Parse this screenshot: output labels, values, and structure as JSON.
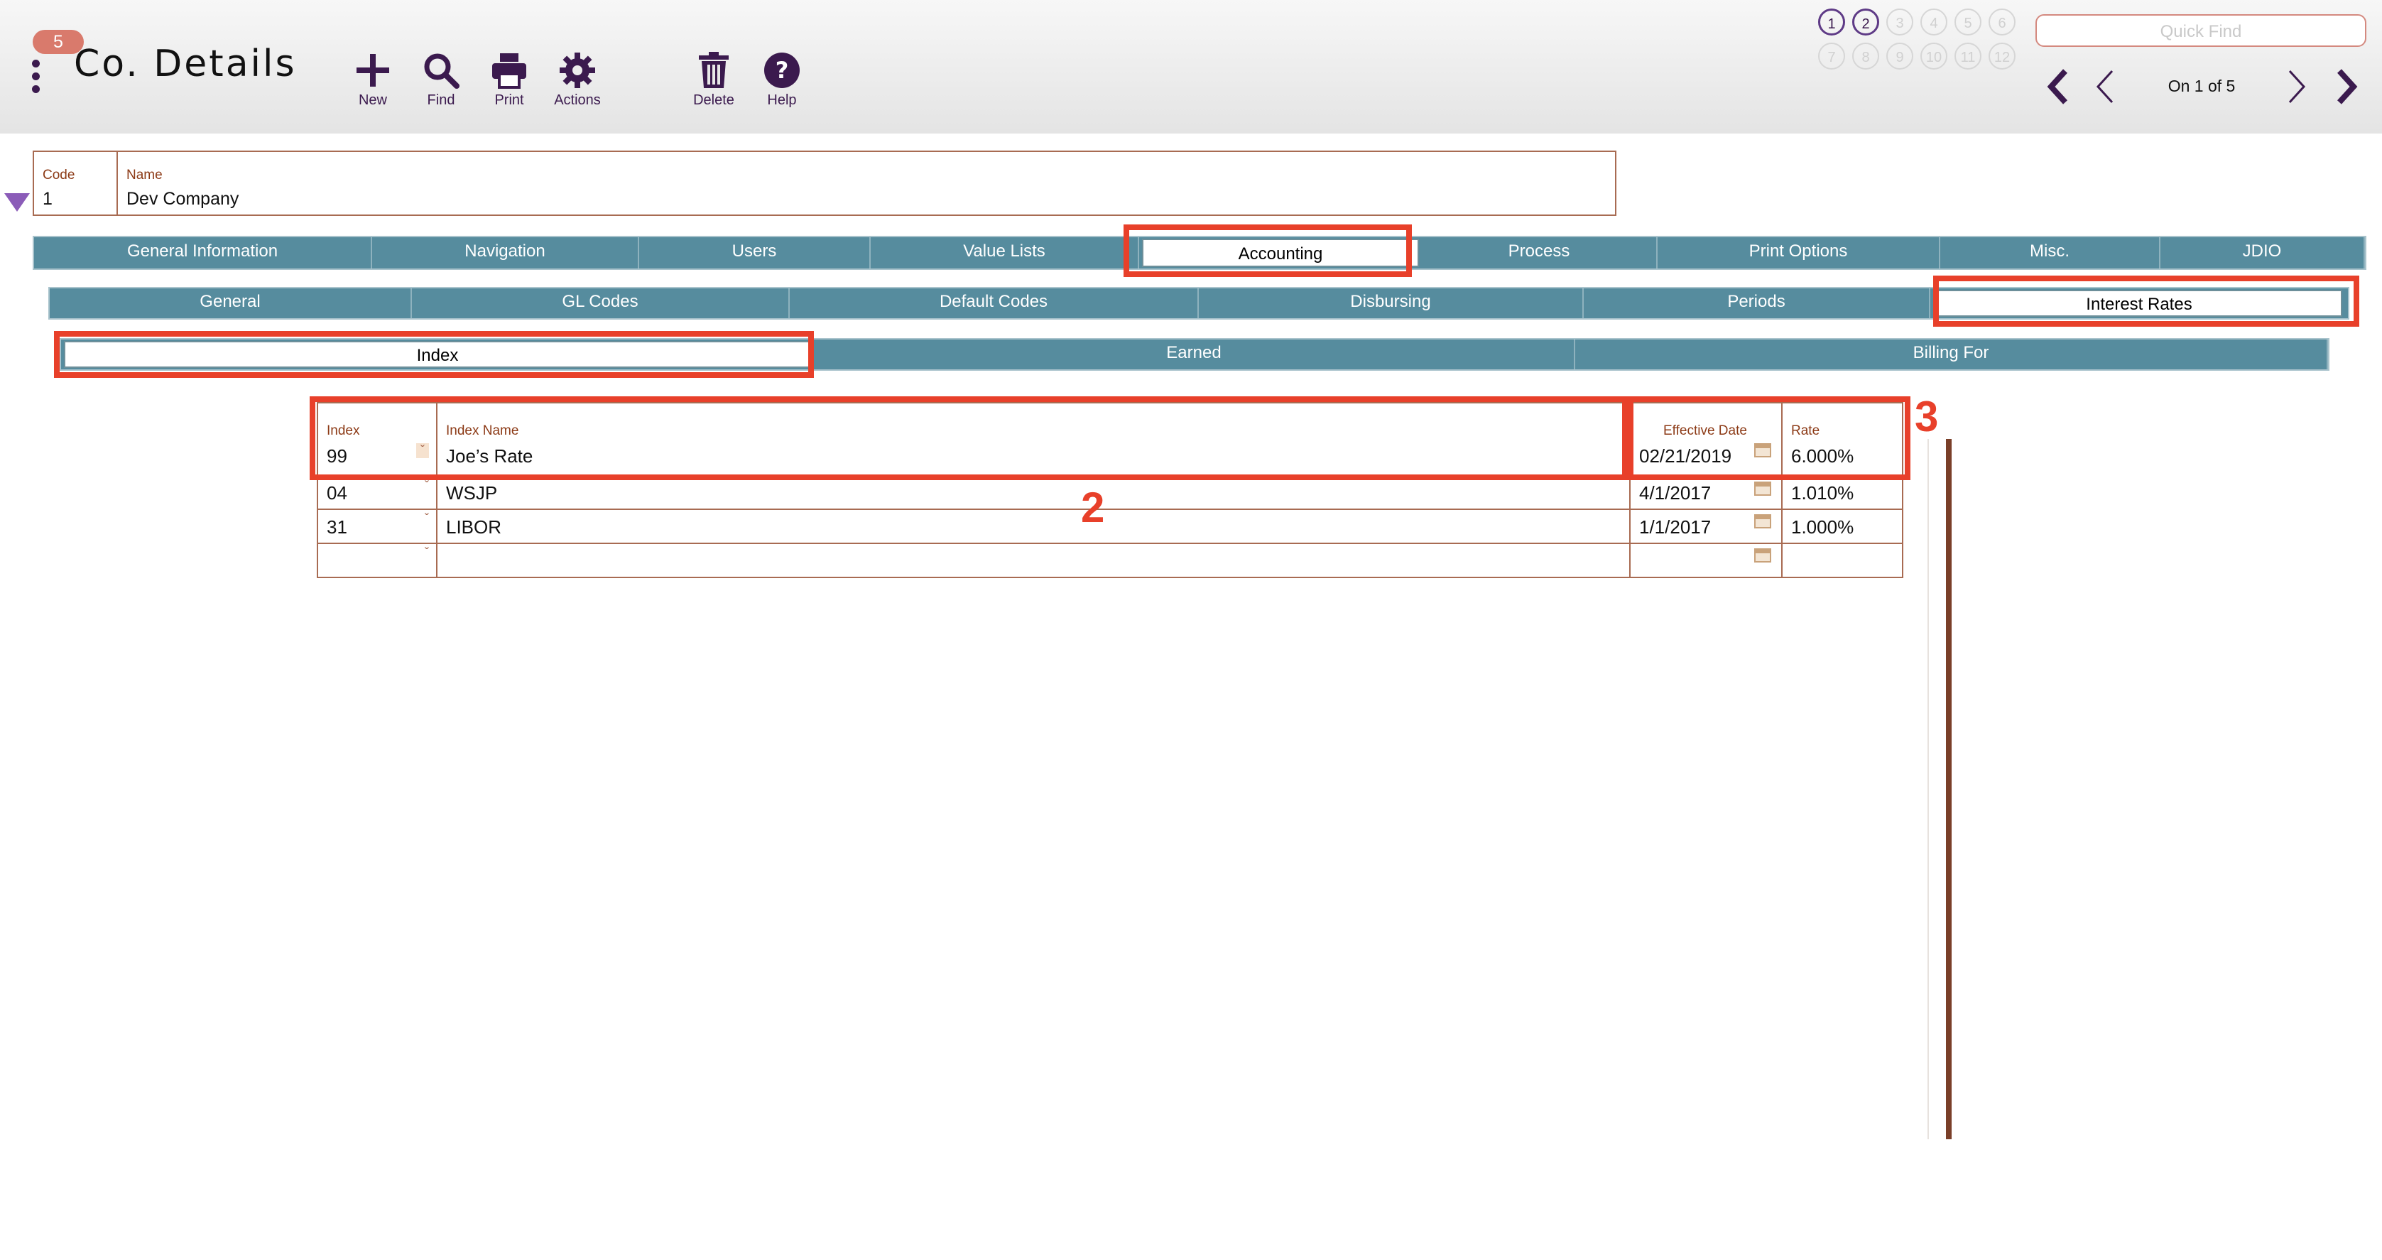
{
  "header": {
    "badge": "5",
    "title": "Co. Details",
    "toolbar": {
      "new_label": "New",
      "find_label": "Find",
      "print_label": "Print",
      "actions_label": "Actions",
      "delete_label": "Delete",
      "help_label": "Help"
    },
    "window_circles": [
      "1",
      "2",
      "3",
      "4",
      "5",
      "6",
      "7",
      "8",
      "9",
      "10",
      "11",
      "12"
    ],
    "active_circles": [
      "1",
      "2"
    ],
    "quick_find_placeholder": "Quick Find",
    "record_position": "On 1 of 5"
  },
  "record": {
    "code_label": "Code",
    "code_value": "1",
    "name_label": "Name",
    "name_value": "Dev Company"
  },
  "main_tabs": [
    "General Information",
    "Navigation",
    "Users",
    "Value Lists",
    "Accounting",
    "Process",
    "Print Options",
    "Misc.",
    "JDIO"
  ],
  "main_tab_active": "Accounting",
  "sub_tabs": [
    "General",
    "GL Codes",
    "Default Codes",
    "Disbursing",
    "Periods",
    "Interest Rates"
  ],
  "sub_tab_active": "Interest Rates",
  "rate_tabs": [
    "Index",
    "Earned",
    "Billing For"
  ],
  "rate_tab_active": "Index",
  "grid": {
    "headers": {
      "index": "Index",
      "index_name": "Index Name",
      "effective_date": "Effective Date",
      "rate": "Rate"
    },
    "rows": [
      {
        "index": "99",
        "name": "Joe’s Rate",
        "date": "02/21/2019",
        "rate": "6.000%"
      },
      {
        "index": "04",
        "name": "WSJP",
        "date": "4/1/2017",
        "rate": "1.010%"
      },
      {
        "index": "31",
        "name": "LIBOR",
        "date": "1/1/2017",
        "rate": "1.000%"
      },
      {
        "index": "",
        "name": "",
        "date": "",
        "rate": ""
      }
    ]
  },
  "annotations": {
    "marker_2": "2",
    "marker_3": "3"
  },
  "colors": {
    "tab_bg": "#568c9e",
    "highlight": "#e8402a",
    "toolbar_icon": "#3b1a4e",
    "field_border": "#a86b52",
    "field_label": "#8c3a16"
  }
}
